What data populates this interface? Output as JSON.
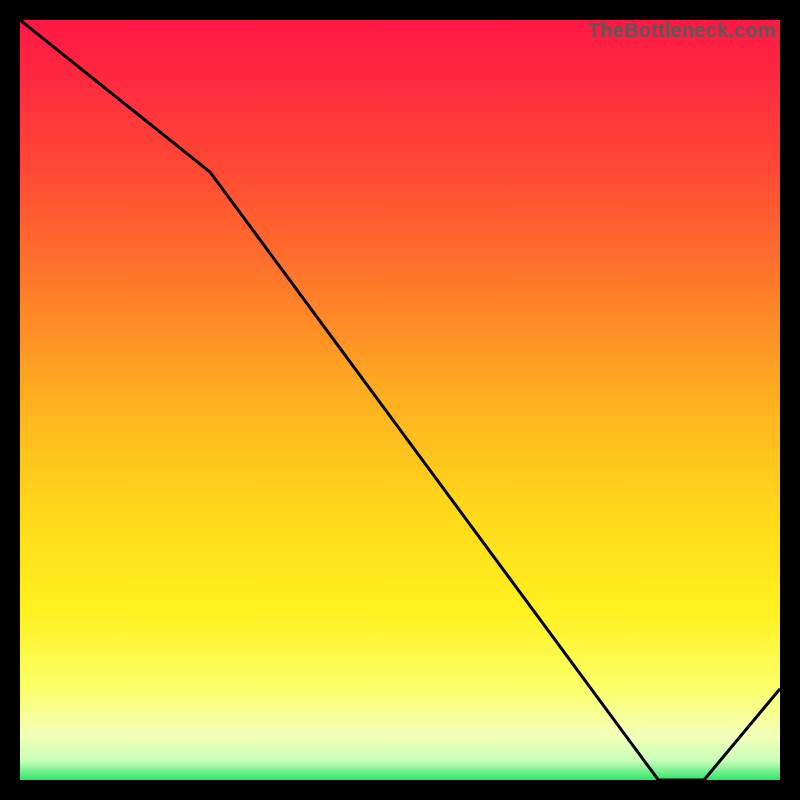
{
  "watermark": "TheBottleneck.com",
  "annotation_label": "",
  "chart_data": {
    "type": "line",
    "title": "",
    "xlabel": "",
    "ylabel": "",
    "xlim": [
      0,
      100
    ],
    "ylim": [
      0,
      100
    ],
    "series": [
      {
        "name": "curve",
        "x": [
          0,
          25,
          84,
          90,
          100
        ],
        "y": [
          100,
          80,
          0,
          0,
          12
        ]
      }
    ],
    "gradient_stops": [
      {
        "offset": 0.0,
        "color": "#ff1744"
      },
      {
        "offset": 0.08,
        "color": "#ff2a3f"
      },
      {
        "offset": 0.2,
        "color": "#ff4a33"
      },
      {
        "offset": 0.35,
        "color": "#ff7a2a"
      },
      {
        "offset": 0.5,
        "color": "#ffb020"
      },
      {
        "offset": 0.65,
        "color": "#ffd91a"
      },
      {
        "offset": 0.78,
        "color": "#fff220"
      },
      {
        "offset": 0.88,
        "color": "#fbff6a"
      },
      {
        "offset": 0.94,
        "color": "#f4ffb8"
      },
      {
        "offset": 0.975,
        "color": "#c8ffb8"
      },
      {
        "offset": 1.0,
        "color": "#2ee56b"
      }
    ],
    "annotation": {
      "x": 84,
      "y": 1
    }
  }
}
